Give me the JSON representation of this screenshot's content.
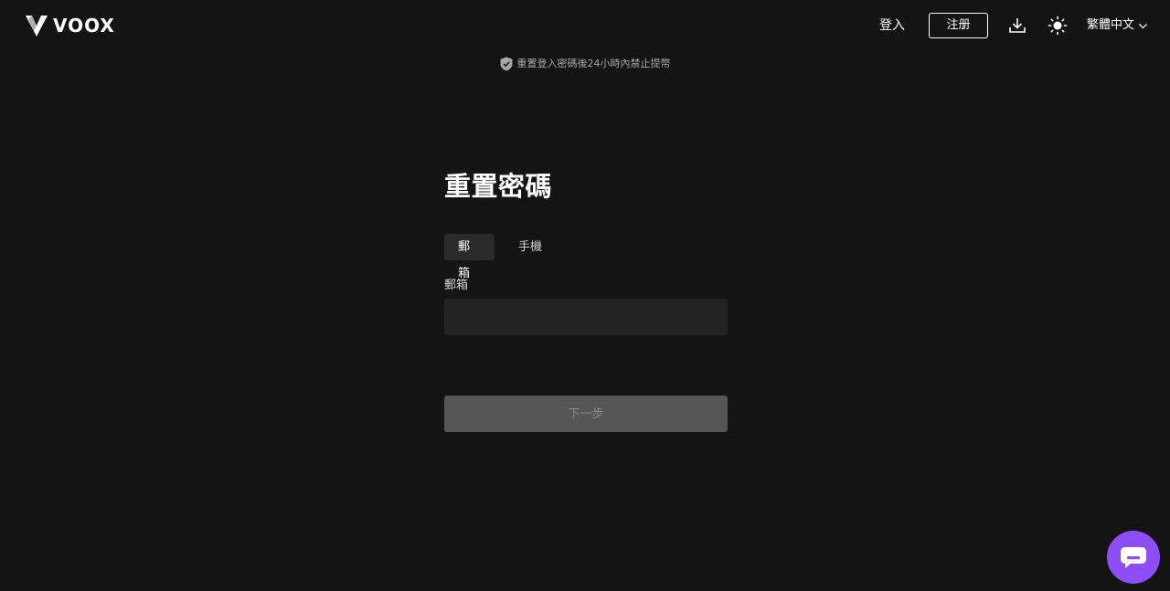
{
  "brand": {
    "name": "VOOX",
    "logo_icon": "voox-logo-icon"
  },
  "nav": {
    "login_label": "登入",
    "register_label": "注册",
    "download_icon": "download-icon",
    "theme_icon": "sun-icon",
    "language_label": "繁體中文",
    "language_chevron_icon": "chevron-down-icon"
  },
  "notice": {
    "icon": "shield-check-icon",
    "text": "重置登入密碼後24小時內禁止提幣"
  },
  "form": {
    "title": "重置密碼",
    "tabs": [
      {
        "label": "郵箱",
        "active": true
      },
      {
        "label": "手機",
        "active": false
      }
    ],
    "email_label": "郵箱",
    "email_value": "",
    "email_placeholder": "",
    "next_label": "下一步"
  },
  "chat": {
    "icon": "chat-bubble-icon"
  },
  "colors": {
    "background": "#141414",
    "input_background": "#232323",
    "disabled_button": "#555555",
    "chat_accent": "#8d4ef5"
  }
}
